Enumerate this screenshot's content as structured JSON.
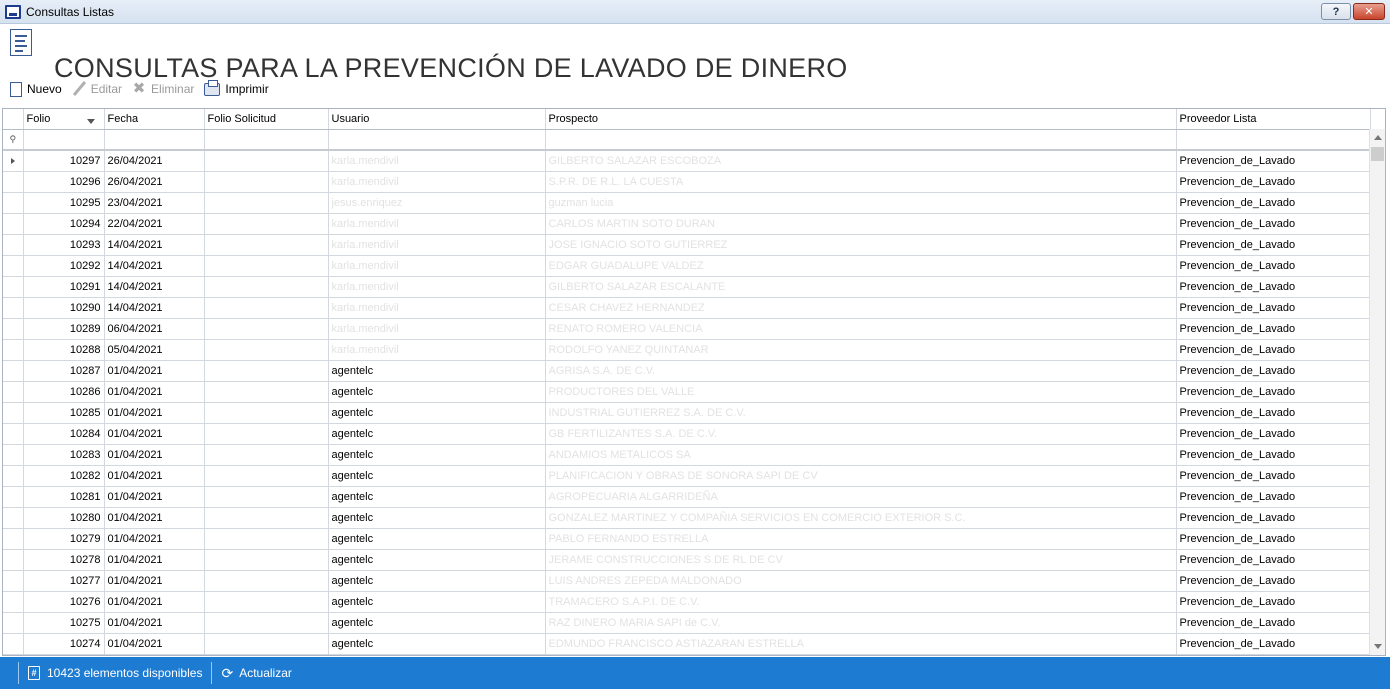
{
  "window": {
    "title": "Consultas Listas",
    "help_label": "?",
    "close_label": "✕"
  },
  "header": {
    "title": "CONSULTAS PARA LA PREVENCIÓN DE LAVADO DE DINERO"
  },
  "toolbar": {
    "new_label": "Nuevo",
    "edit_label": "Editar",
    "delete_label": "Eliminar",
    "print_label": "Imprimir"
  },
  "grid": {
    "columns": [
      "Folio",
      "Fecha",
      "Folio Solicitud",
      "Usuario",
      "Prospecto",
      "Proveedor Lista"
    ],
    "rows": [
      {
        "folio": "10297",
        "fecha": "26/04/2021",
        "folio_solicitud": "",
        "usuario": "karla.mendivil",
        "prospecto": "GILBERTO SALAZAR ESCOBOZA",
        "proveedor": "Prevencion_de_Lavado"
      },
      {
        "folio": "10296",
        "fecha": "26/04/2021",
        "folio_solicitud": "",
        "usuario": "karla.mendivil",
        "prospecto": "S.P.R. DE R.L. LA CUESTA",
        "proveedor": "Prevencion_de_Lavado"
      },
      {
        "folio": "10295",
        "fecha": "23/04/2021",
        "folio_solicitud": "",
        "usuario": "jesus.enriquez",
        "prospecto": "guzman lucia",
        "proveedor": "Prevencion_de_Lavado"
      },
      {
        "folio": "10294",
        "fecha": "22/04/2021",
        "folio_solicitud": "",
        "usuario": "karla.mendivil",
        "prospecto": "CARLOS MARTIN SOTO DURAN",
        "proveedor": "Prevencion_de_Lavado"
      },
      {
        "folio": "10293",
        "fecha": "14/04/2021",
        "folio_solicitud": "",
        "usuario": "karla.mendivil",
        "prospecto": "JOSE IGNACIO SOTO GUTIERREZ",
        "proveedor": "Prevencion_de_Lavado"
      },
      {
        "folio": "10292",
        "fecha": "14/04/2021",
        "folio_solicitud": "",
        "usuario": "karla.mendivil",
        "prospecto": "EDGAR GUADALUPE VALDEZ",
        "proveedor": "Prevencion_de_Lavado"
      },
      {
        "folio": "10291",
        "fecha": "14/04/2021",
        "folio_solicitud": "",
        "usuario": "karla.mendivil",
        "prospecto": "GILBERTO SALAZAR ESCALANTE",
        "proveedor": "Prevencion_de_Lavado"
      },
      {
        "folio": "10290",
        "fecha": "14/04/2021",
        "folio_solicitud": "",
        "usuario": "karla.mendivil",
        "prospecto": "CESAR CHAVEZ HERNANDEZ",
        "proveedor": "Prevencion_de_Lavado"
      },
      {
        "folio": "10289",
        "fecha": "06/04/2021",
        "folio_solicitud": "",
        "usuario": "karla.mendivil",
        "prospecto": "RENATO ROMERO VALENCIA",
        "proveedor": "Prevencion_de_Lavado"
      },
      {
        "folio": "10288",
        "fecha": "05/04/2021",
        "folio_solicitud": "",
        "usuario": "karla.mendivil",
        "prospecto": "RODOLFO YANEZ QUINTANAR",
        "proveedor": "Prevencion_de_Lavado"
      },
      {
        "folio": "10287",
        "fecha": "01/04/2021",
        "folio_solicitud": "",
        "usuario": "agentelc",
        "prospecto": "AGRISA S.A. DE C.V.",
        "proveedor": "Prevencion_de_Lavado"
      },
      {
        "folio": "10286",
        "fecha": "01/04/2021",
        "folio_solicitud": "",
        "usuario": "agentelc",
        "prospecto": "PRODUCTORES DEL VALLE",
        "proveedor": "Prevencion_de_Lavado"
      },
      {
        "folio": "10285",
        "fecha": "01/04/2021",
        "folio_solicitud": "",
        "usuario": "agentelc",
        "prospecto": "INDUSTRIAL GUTIERREZ S.A. DE C.V.",
        "proveedor": "Prevencion_de_Lavado"
      },
      {
        "folio": "10284",
        "fecha": "01/04/2021",
        "folio_solicitud": "",
        "usuario": "agentelc",
        "prospecto": "GB FERTILIZANTES S.A. DE C.V.",
        "proveedor": "Prevencion_de_Lavado"
      },
      {
        "folio": "10283",
        "fecha": "01/04/2021",
        "folio_solicitud": "",
        "usuario": "agentelc",
        "prospecto": "ANDAMIOS METALICOS SA",
        "proveedor": "Prevencion_de_Lavado"
      },
      {
        "folio": "10282",
        "fecha": "01/04/2021",
        "folio_solicitud": "",
        "usuario": "agentelc",
        "prospecto": "PLANIFICACION Y OBRAS DE SONORA SAPI DE CV",
        "proveedor": "Prevencion_de_Lavado"
      },
      {
        "folio": "10281",
        "fecha": "01/04/2021",
        "folio_solicitud": "",
        "usuario": "agentelc",
        "prospecto": "AGROPECUARIA ALGARRIDEÑA",
        "proveedor": "Prevencion_de_Lavado"
      },
      {
        "folio": "10280",
        "fecha": "01/04/2021",
        "folio_solicitud": "",
        "usuario": "agentelc",
        "prospecto": "GONZALEZ MARTINEZ Y COMPAÑIA SERVICIOS EN COMERCIO EXTERIOR S.C.",
        "proveedor": "Prevencion_de_Lavado"
      },
      {
        "folio": "10279",
        "fecha": "01/04/2021",
        "folio_solicitud": "",
        "usuario": "agentelc",
        "prospecto": "PABLO FERNANDO ESTRELLA",
        "proveedor": "Prevencion_de_Lavado"
      },
      {
        "folio": "10278",
        "fecha": "01/04/2021",
        "folio_solicitud": "",
        "usuario": "agentelc",
        "prospecto": "JERAME CONSTRUCCIONES S DE RL DE CV",
        "proveedor": "Prevencion_de_Lavado"
      },
      {
        "folio": "10277",
        "fecha": "01/04/2021",
        "folio_solicitud": "",
        "usuario": "agentelc",
        "prospecto": "LUIS ANDRES ZEPEDA MALDONADO",
        "proveedor": "Prevencion_de_Lavado"
      },
      {
        "folio": "10276",
        "fecha": "01/04/2021",
        "folio_solicitud": "",
        "usuario": "agentelc",
        "prospecto": "TRAMACERO S.A.P.I. DE C.V.",
        "proveedor": "Prevencion_de_Lavado"
      },
      {
        "folio": "10275",
        "fecha": "01/04/2021",
        "folio_solicitud": "",
        "usuario": "agentelc",
        "prospecto": "RAZ DINERO MARIA SAPI de C.V.",
        "proveedor": "Prevencion_de_Lavado"
      },
      {
        "folio": "10274",
        "fecha": "01/04/2021",
        "folio_solicitud": "",
        "usuario": "agentelc",
        "prospecto": "EDMUNDO FRANCISCO ASTIAZARAN ESTRELLA",
        "proveedor": "Prevencion_de_Lavado"
      }
    ]
  },
  "status": {
    "count_text": "10423 elementos disponibles",
    "refresh_label": "Actualizar"
  },
  "colors": {
    "accent": "#1e7bd2",
    "muted_text": "#e2e2e2"
  }
}
